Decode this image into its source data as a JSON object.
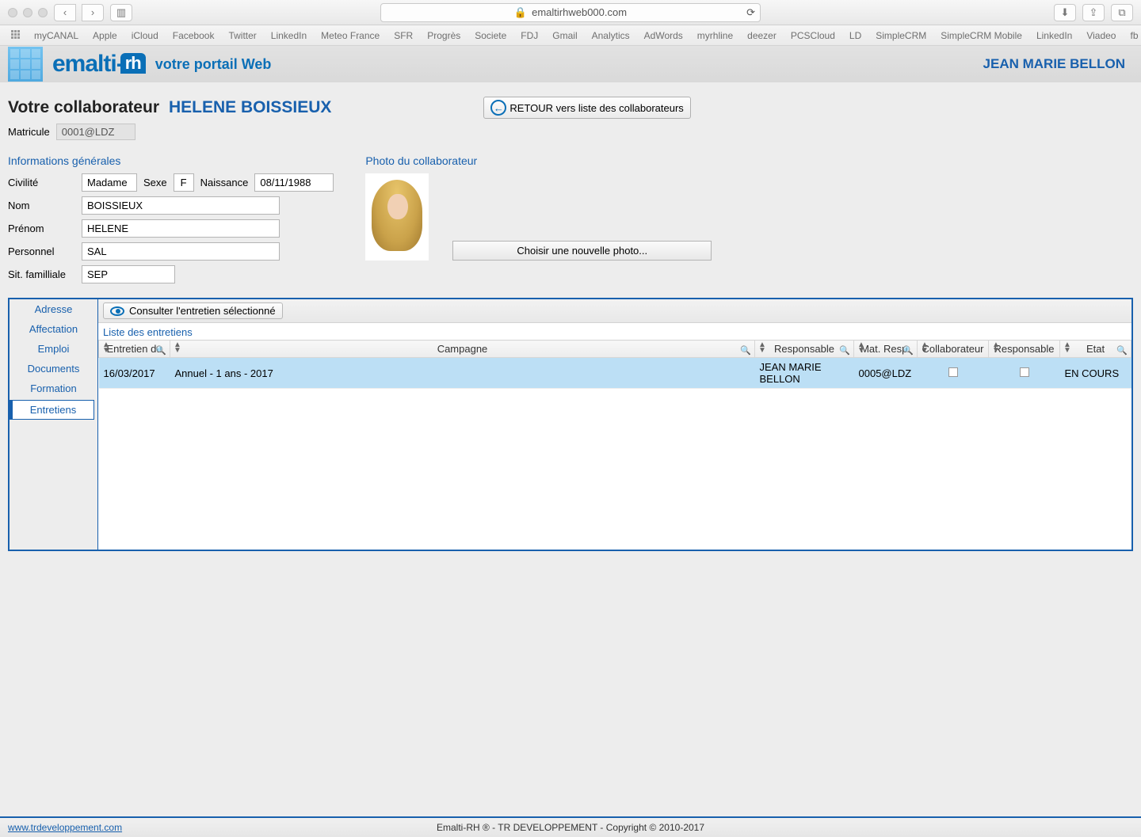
{
  "browser": {
    "url": "emaltirhweb000.com",
    "bookmarks": [
      "myCANAL",
      "Apple",
      "iCloud",
      "Facebook",
      "Twitter",
      "LinkedIn",
      "Meteo France",
      "SFR",
      "Progrès",
      "Societe",
      "FDJ",
      "Gmail",
      "Analytics",
      "AdWords",
      "myrhline",
      "deezer",
      "PCSCloud",
      "LD",
      "SimpleCRM",
      "SimpleCRM Mobile",
      "LinkedIn",
      "Viadeo",
      "fb"
    ]
  },
  "header": {
    "brand": "emalti-",
    "brand_suffix": "rh",
    "tagline": "votre portail Web",
    "user": "JEAN MARIE BELLON"
  },
  "page": {
    "title": "Votre collaborateur",
    "collab_name": "HELENE BOISSIEUX",
    "back_label": "RETOUR vers liste des collaborateurs",
    "matricule_label": "Matricule",
    "matricule_value": "0001@LDZ"
  },
  "info": {
    "section_title": "Informations générales",
    "labels": {
      "civilite": "Civilité",
      "sexe": "Sexe",
      "naissance": "Naissance",
      "nom": "Nom",
      "prenom": "Prénom",
      "personnel": "Personnel",
      "sitfam": "Sit. familliale"
    },
    "values": {
      "civilite": "Madame",
      "sexe": "F",
      "naissance": "08/11/1988",
      "nom": "BOISSIEUX",
      "prenom": "HELENE",
      "personnel": "SAL",
      "sitfam": "SEP"
    }
  },
  "photo": {
    "section_title": "Photo du collaborateur",
    "choose_label": "Choisir une nouvelle photo..."
  },
  "tabs": [
    "Adresse",
    "Affectation",
    "Emploi",
    "Documents",
    "Formation",
    "Entretiens"
  ],
  "entretiens": {
    "consult_label": "Consulter l'entretien sélectionné",
    "list_title": "Liste des entretiens",
    "columns": [
      "Entretien du",
      "Campagne",
      "Responsable",
      "Mat. Resp.",
      "Collaborateur",
      "Responsable",
      "Etat"
    ],
    "rows": [
      {
        "date": "16/03/2017",
        "campagne": "Annuel - 1 ans - 2017",
        "responsable": "JEAN MARIE BELLON",
        "matresp": "0005@LDZ",
        "collab_check": false,
        "resp_check": false,
        "etat": "EN COURS"
      }
    ]
  },
  "footer": {
    "link": "www.trdeveloppement.com",
    "copyright": "Emalti-RH ® - TR DEVELOPPEMENT - Copyright © 2010-2017"
  }
}
